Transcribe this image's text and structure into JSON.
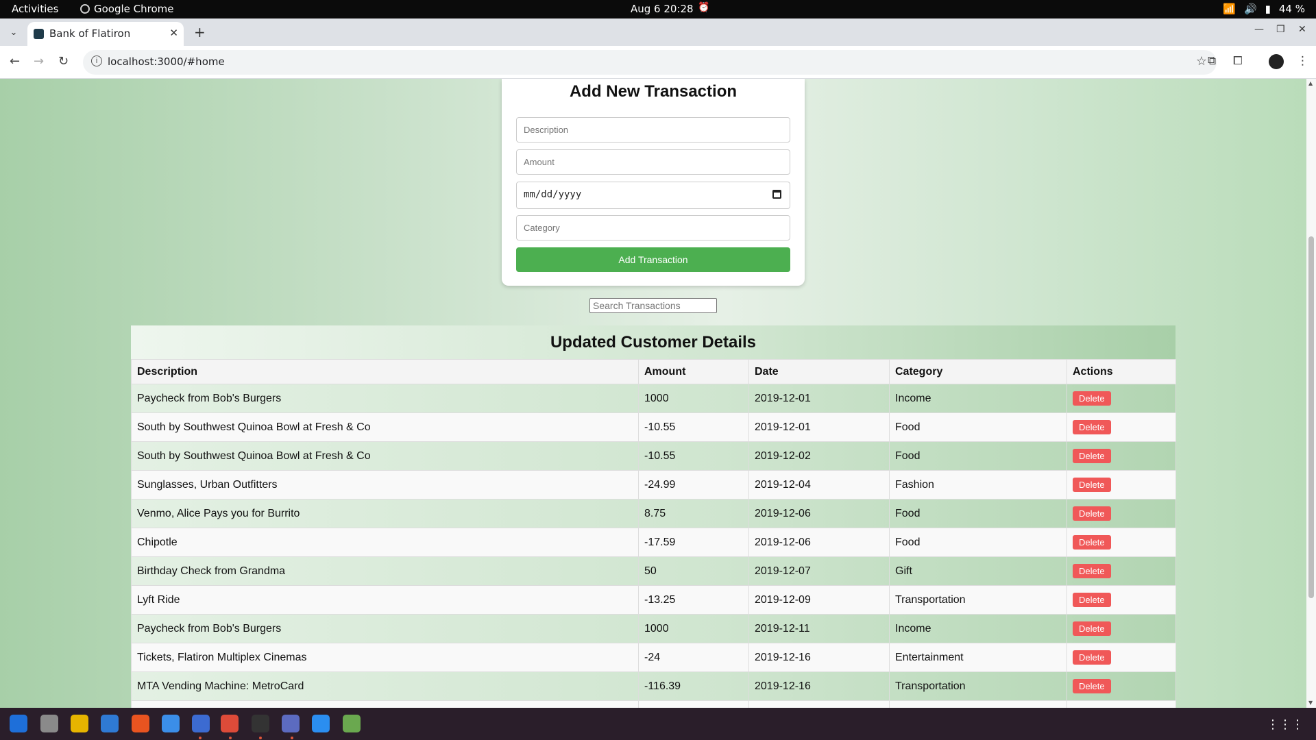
{
  "system": {
    "activities": "Activities",
    "app_name": "Google Chrome",
    "clock": "Aug 6  20:28",
    "battery": "44 %"
  },
  "browser": {
    "tab_title": "Bank of Flatiron",
    "url": "localhost:3000/#home"
  },
  "form": {
    "title": "Add New Transaction",
    "description_placeholder": "Description",
    "amount_placeholder": "Amount",
    "date_mask": "mm/dd/yyyy",
    "category_placeholder": "Category",
    "submit_label": "Add Transaction"
  },
  "search": {
    "placeholder": "Search Transactions"
  },
  "table": {
    "title": "Updated Customer Details",
    "headers": [
      "Description",
      "Amount",
      "Date",
      "Category",
      "Actions"
    ],
    "delete_label": "Delete",
    "rows": [
      {
        "description": "Paycheck from Bob's Burgers",
        "amount": "1000",
        "date": "2019-12-01",
        "category": "Income"
      },
      {
        "description": "South by Southwest Quinoa Bowl at Fresh & Co",
        "amount": "-10.55",
        "date": "2019-12-01",
        "category": "Food"
      },
      {
        "description": "South by Southwest Quinoa Bowl at Fresh & Co",
        "amount": "-10.55",
        "date": "2019-12-02",
        "category": "Food"
      },
      {
        "description": "Sunglasses, Urban Outfitters",
        "amount": "-24.99",
        "date": "2019-12-04",
        "category": "Fashion"
      },
      {
        "description": "Venmo, Alice Pays you for Burrito",
        "amount": "8.75",
        "date": "2019-12-06",
        "category": "Food"
      },
      {
        "description": "Chipotle",
        "amount": "-17.59",
        "date": "2019-12-06",
        "category": "Food"
      },
      {
        "description": "Birthday Check from Grandma",
        "amount": "50",
        "date": "2019-12-07",
        "category": "Gift"
      },
      {
        "description": "Lyft Ride",
        "amount": "-13.25",
        "date": "2019-12-09",
        "category": "Transportation"
      },
      {
        "description": "Paycheck from Bob's Burgers",
        "amount": "1000",
        "date": "2019-12-11",
        "category": "Income"
      },
      {
        "description": "Tickets, Flatiron Multiplex Cinemas",
        "amount": "-24",
        "date": "2019-12-16",
        "category": "Entertainment"
      },
      {
        "description": "MTA Vending Machine: MetroCard",
        "amount": "-116.39",
        "date": "2019-12-16",
        "category": "Transportation"
      },
      {
        "description": "",
        "amount": "",
        "date": "",
        "category": ""
      }
    ]
  },
  "dock": {
    "items": [
      "firefox-icon",
      "files-icon",
      "rhythmbox-icon",
      "writer-icon",
      "app-center-icon",
      "help-icon",
      "updater-icon",
      "chrome-icon",
      "terminal-icon",
      "text-editor-icon",
      "vscode-icon",
      "trash-icon"
    ]
  }
}
